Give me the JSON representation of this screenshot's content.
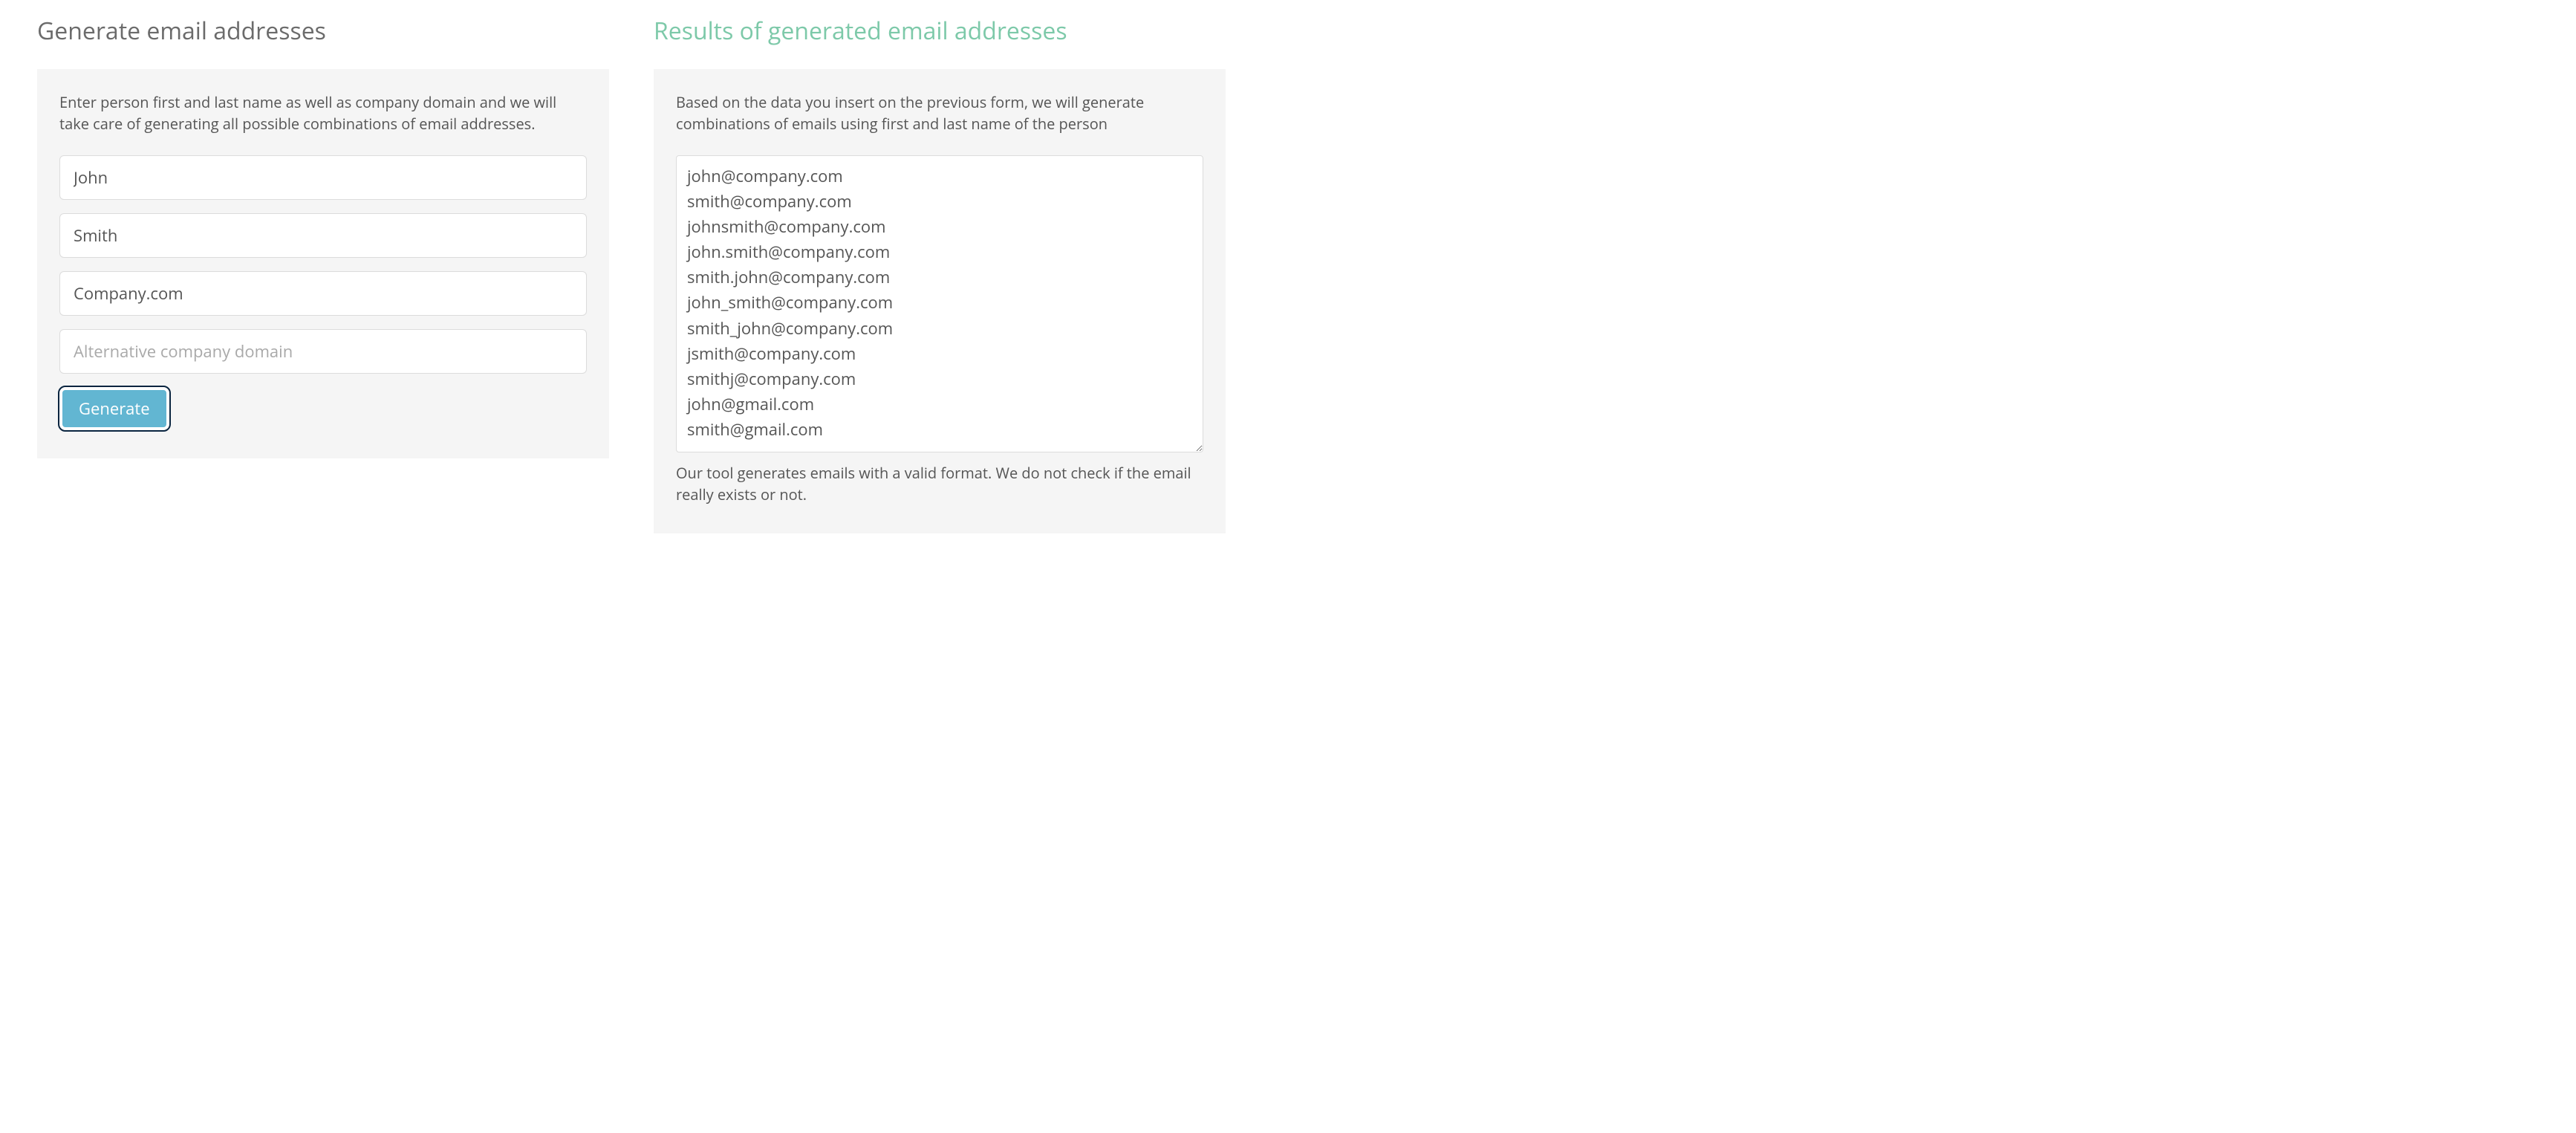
{
  "left": {
    "heading": "Generate email addresses",
    "description": "Enter person first and last name as well as company domain and we will take care of generating all possible combinations of email addresses.",
    "first_name": "John",
    "last_name": "Smith",
    "company_domain": "Company.com",
    "alt_domain_placeholder": "Alternative company domain",
    "generate_label": "Generate"
  },
  "right": {
    "heading": "Results of generated email addresses",
    "description": "Based on the data you insert on the previous form, we will generate combinations of emails using first and last name of the person",
    "results": "john@company.com\nsmith@company.com\njohnsmith@company.com\njohn.smith@company.com\nsmith.john@company.com\njohn_smith@company.com\nsmith_john@company.com\njsmith@company.com\nsmithj@company.com\njohn@gmail.com\nsmith@gmail.com",
    "footnote": "Our tool generates emails with a valid format. We do not check if the email really exists or not."
  }
}
